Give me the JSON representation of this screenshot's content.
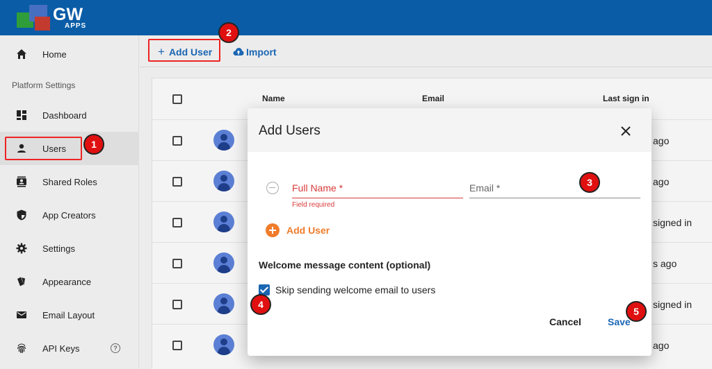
{
  "app": {
    "logo_text": "GW",
    "logo_sub": "APPS"
  },
  "sidebar": {
    "heading": "Platform Settings",
    "items": [
      {
        "label": "Home",
        "icon": "home-icon"
      },
      {
        "label": "Dashboard",
        "icon": "dashboard-icon"
      },
      {
        "label": "Users",
        "icon": "person-icon"
      },
      {
        "label": "Shared Roles",
        "icon": "roles-icon"
      },
      {
        "label": "App Creators",
        "icon": "shield-icon"
      },
      {
        "label": "Settings",
        "icon": "gear-icon"
      },
      {
        "label": "Appearance",
        "icon": "appearance-icon"
      },
      {
        "label": "Email Layout",
        "icon": "mail-icon"
      },
      {
        "label": "API Keys",
        "icon": "fingerprint-icon"
      }
    ],
    "help_glyph": "?"
  },
  "toolbar": {
    "add_user_label": "Add User",
    "import_label": "Import"
  },
  "table": {
    "columns": [
      "Name",
      "Email",
      "Last sign in"
    ],
    "rows_last_sign_in": [
      "ago",
      "ago",
      "signed in",
      "s ago",
      "signed in",
      "ago"
    ]
  },
  "modal": {
    "title": "Add Users",
    "fullname_placeholder": "Full Name *",
    "email_placeholder": "Email *",
    "error_text": "Field required",
    "add_user_label": "Add User",
    "welcome_heading": "Welcome message content (optional)",
    "skip_label": "Skip sending welcome email to users",
    "skip_checked": true,
    "cancel_label": "Cancel",
    "save_label": "Save"
  },
  "annotations": [
    "1",
    "2",
    "3",
    "4",
    "5"
  ],
  "colors": {
    "brand": "#0a5ca6",
    "accent_orange": "#f07c2b",
    "error": "#d93a3a",
    "link": "#1a66b3",
    "annotation": "#e01010"
  }
}
